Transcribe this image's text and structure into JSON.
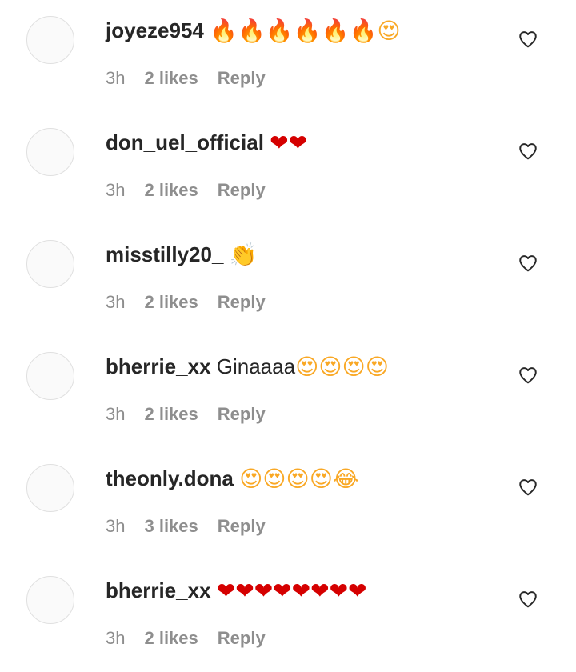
{
  "comments": [
    {
      "username": "joyeze954",
      "text": "",
      "emojis": [
        {
          "char": "🔥",
          "icon": "fire-emoji"
        },
        {
          "char": "🔥",
          "icon": "fire-emoji"
        },
        {
          "char": "🔥",
          "icon": "fire-emoji"
        },
        {
          "char": "🔥",
          "icon": "fire-emoji"
        },
        {
          "char": "🔥",
          "icon": "fire-emoji"
        },
        {
          "char": "🔥",
          "icon": "fire-emoji"
        },
        {
          "char": "😍",
          "icon": "heart-eyes-emoji"
        }
      ],
      "time": "3h",
      "likes": "2 likes",
      "reply": "Reply"
    },
    {
      "username": "don_uel_official",
      "text": "",
      "emojis": [
        {
          "char": "❤",
          "icon": "red-heart-emoji"
        },
        {
          "char": "❤",
          "icon": "red-heart-emoji"
        }
      ],
      "time": "3h",
      "likes": "2 likes",
      "reply": "Reply"
    },
    {
      "username": "misstilly20_",
      "text": "",
      "emojis": [
        {
          "char": "👏",
          "icon": "clapping-hands-emoji"
        }
      ],
      "time": "3h",
      "likes": "2 likes",
      "reply": "Reply"
    },
    {
      "username": "bherrie_xx",
      "text": "Ginaaaa",
      "emojis": [
        {
          "char": "😍",
          "icon": "heart-eyes-emoji"
        },
        {
          "char": "😍",
          "icon": "heart-eyes-emoji"
        },
        {
          "char": "😍",
          "icon": "heart-eyes-emoji"
        },
        {
          "char": "😍",
          "icon": "heart-eyes-emoji"
        }
      ],
      "time": "3h",
      "likes": "2 likes",
      "reply": "Reply"
    },
    {
      "username": "theonly.dona",
      "text": "",
      "emojis": [
        {
          "char": "😍",
          "icon": "heart-eyes-emoji"
        },
        {
          "char": "😍",
          "icon": "heart-eyes-emoji"
        },
        {
          "char": "😍",
          "icon": "heart-eyes-emoji"
        },
        {
          "char": "😍",
          "icon": "heart-eyes-emoji"
        },
        {
          "char": "😂",
          "icon": "tears-of-joy-emoji"
        }
      ],
      "time": "3h",
      "likes": "3 likes",
      "reply": "Reply"
    },
    {
      "username": "bherrie_xx",
      "text": "",
      "emojis": [
        {
          "char": "❤",
          "icon": "red-heart-emoji"
        },
        {
          "char": "❤",
          "icon": "red-heart-emoji"
        },
        {
          "char": "❤",
          "icon": "red-heart-emoji"
        },
        {
          "char": "❤",
          "icon": "red-heart-emoji"
        },
        {
          "char": "❤",
          "icon": "red-heart-emoji"
        },
        {
          "char": "❤",
          "icon": "red-heart-emoji"
        },
        {
          "char": "❤",
          "icon": "red-heart-emoji"
        },
        {
          "char": "❤",
          "icon": "red-heart-emoji"
        }
      ],
      "time": "3h",
      "likes": "2 likes",
      "reply": "Reply"
    }
  ],
  "like_icon": "heart-outline-icon",
  "colors": {
    "text": "#262626",
    "secondary": "#8e8e8e",
    "avatar_border": "#e0e0e0"
  }
}
